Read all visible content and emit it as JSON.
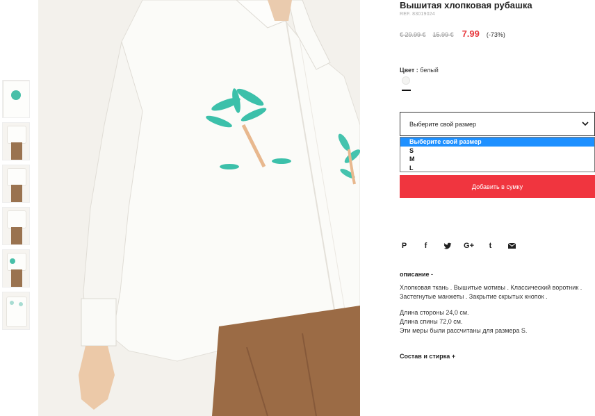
{
  "product": {
    "title": "Вышитая хлопковая рубашка",
    "ref": "REF. 83019024",
    "price_original": "€ 29.99 €",
    "price_previous": "15.99 €",
    "price_current": "7.99",
    "discount": "(-73%)"
  },
  "color": {
    "label": "Цвет :",
    "value": "белый",
    "swatch_color": "#f4f4f2"
  },
  "size": {
    "placeholder": "Выберите свой размер",
    "options": [
      "Выберите свой размер",
      "S",
      "M",
      "L"
    ],
    "selected_index": 0
  },
  "cart": {
    "add_label": "Добавить в сумку",
    "button_color": "#f0353f"
  },
  "share": {
    "icons": [
      "pinterest-icon",
      "facebook-icon",
      "twitter-icon",
      "google-plus-icon",
      "tumblr-icon",
      "email-icon"
    ],
    "glyphs": [
      "P",
      "f",
      "t",
      "G+",
      "t",
      "✉"
    ]
  },
  "description": {
    "heading": "описание -",
    "lines": [
      "Хлопковая ткань . Вышитые мотивы . Классический воротник .",
      "Застегнутые манжеты . Закрытие скрытых кнопок .",
      "Длина стороны 24,0 см.",
      "Длина спины 72,0 см.",
      "Эти меры были рассчитаны для размера S."
    ]
  },
  "composition": {
    "label": "Состав и стирка +"
  },
  "thumbnails": {
    "count": 6
  }
}
